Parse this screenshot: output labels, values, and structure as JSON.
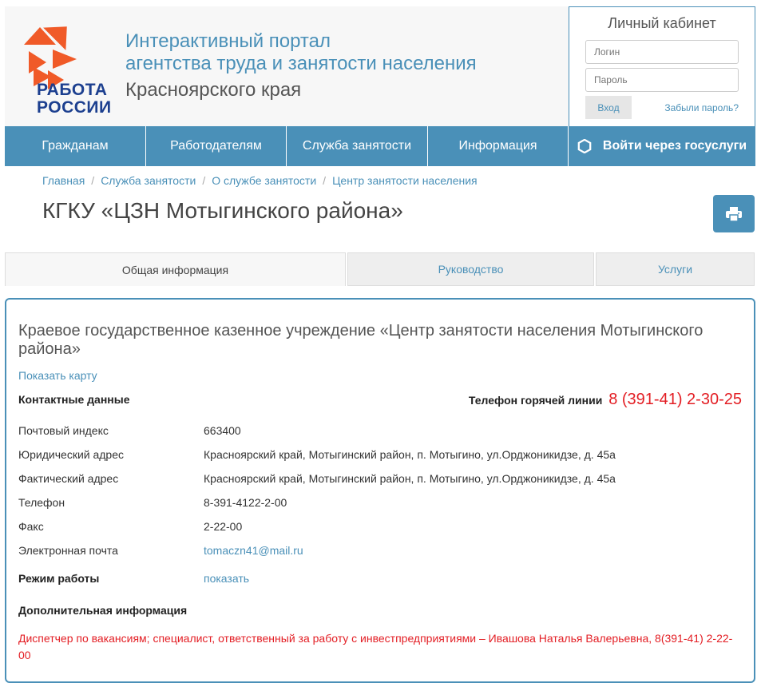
{
  "header": {
    "logo_line1": "РАБОТА",
    "logo_line2": "РОССИИ",
    "portal_title_line1": "Интерактивный портал",
    "portal_title_line2": "агентства труда и занятости населения",
    "portal_region": "Красноярского края"
  },
  "cabinet": {
    "title": "Личный кабинет",
    "login_placeholder": "Логин",
    "password_placeholder": "Пароль",
    "login_button": "Вход",
    "forgot_password": "Забыли пароль?"
  },
  "nav": {
    "items": [
      "Гражданам",
      "Работодателям",
      "Служба занятости",
      "Информация"
    ],
    "gosuslugi": "Войти через госуслуги"
  },
  "breadcrumb": [
    "Главная",
    "Служба занятости",
    "О службе занятости",
    "Центр занятости населения"
  ],
  "page_title": "КГКУ «ЦЗН Мотыгинского района»",
  "tabs": [
    "Общая информация",
    "Руководство",
    "Услуги"
  ],
  "content": {
    "org_name": "Краевое государственное казенное учреждение «Центр занятости населения Мотыгинского района»",
    "show_map": "Показать карту",
    "contacts_heading": "Контактные данные",
    "hotline_label": "Телефон горячей линии",
    "hotline_number": "8 (391-41) 2-30-25",
    "fields": [
      {
        "label": "Почтовый индекс",
        "value": "663400"
      },
      {
        "label": "Юридический адрес",
        "value": "Красноярский край, Мотыгинский район, п. Мотыгино, ул.Орджоникидзе, д. 45а"
      },
      {
        "label": "Фактический адрес",
        "value": "Красноярский край, Мотыгинский район, п. Мотыгино, ул.Орджоникидзе, д. 45а"
      },
      {
        "label": "Телефон",
        "value": "8-391-4122-2-00"
      },
      {
        "label": "Факс",
        "value": "2-22-00"
      },
      {
        "label": "Электронная почта",
        "value": "tomaczn41@mail.ru"
      }
    ],
    "work_mode_label": "Режим работы",
    "work_mode_link": "показать",
    "additional_heading": "Дополнительная информация",
    "dispatch_text": "Диспетчер по вакансиям; специалист, ответственный за работу с инвестпредприятиями – Ивашова Наталья Валерьевна, 8(391-41) 2-22-00"
  },
  "colors": {
    "accent": "#4a90b8",
    "logo_orange": "#f05a28",
    "logo_blue": "#1c3f8f",
    "hotline_red": "#e31e24"
  }
}
